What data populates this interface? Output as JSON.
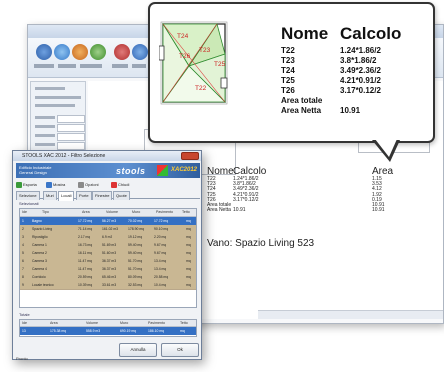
{
  "callout": {
    "header_nome": "Nome",
    "header_calcolo": "Calcolo",
    "rows": [
      {
        "nome": "T22",
        "calcolo": "1.24*1.86/2"
      },
      {
        "nome": "T23",
        "calcolo": "3.8*1.86/2"
      },
      {
        "nome": "T24",
        "calcolo": "3.49*2.36/2"
      },
      {
        "nome": "T25",
        "calcolo": "4.21*0.91/2"
      },
      {
        "nome": "T26",
        "calcolo": "3.17*0.12/2"
      },
      {
        "nome": "Area totale",
        "calcolo": ""
      },
      {
        "nome": "Area Netta",
        "calcolo": "10.91"
      }
    ],
    "plan_labels": {
      "t24": "T24",
      "t26": "T26",
      "t23": "T23",
      "t25": "T25",
      "t22": "T22"
    }
  },
  "report": {
    "header_nome": "Nome",
    "header_calcolo": "Calcolo",
    "header_area": "Area",
    "nomi": "T22\nT23\nT24\nT25\nT26\nArea totale\nArea Netta",
    "calcoli": "1.24*1.86/2\n3.8*1.86/2\n3.49*2.36/2\n4.21*0.91/2\n3.17*0.12/2\n\n10.91",
    "aree": "1.15\n3.53\n4.12\n1.92\n0.19\n10.91\n10.91",
    "vano_label": "Vano: Spazio Living 523"
  },
  "dialog": {
    "title": "STOOLS XAC 2012 - Filtro Selezione",
    "banner_left": "Edificio Industriale\nGeneral Design",
    "banner_brand": "stools",
    "banner_product": "XAC2012",
    "toolbar": [
      "Esporta",
      "Mostra",
      "Opzioni",
      "Chiudi"
    ],
    "tabs": [
      "Selezione",
      "Muri",
      "Locali",
      "Porte",
      "Finestre",
      "Quote"
    ],
    "active_tab": 2,
    "group_selezionati": "Selezionati",
    "columns": [
      "Ide",
      "Tipo",
      "Area",
      "Volume",
      "Muro",
      "Pavimento",
      "Tetto"
    ],
    "rows": [
      {
        "id": "1",
        "tipo": "Bagno",
        "area": "17.72 mq",
        "volume": "56.27 m3",
        "muro": "70.02 mq",
        "pav": "17.72 mq",
        "tetto": "mq"
      },
      {
        "id": "2",
        "tipo": "Spazio Living",
        "area": "71.14 mq",
        "volume": "161.02 m3",
        "muro": "178.90 mq",
        "pav": "90.10 mq",
        "tetto": "mq"
      },
      {
        "id": "3",
        "tipo": "Ripostiglio",
        "area": "2.17 mq",
        "volume": "6.9 m3",
        "muro": "19.12 mq",
        "pav": "2.20 mq",
        "tetto": "mq"
      },
      {
        "id": "4",
        "tipo": "Camera 1",
        "area": "16.73 mq",
        "volume": "51.69 m3",
        "muro": "59.40 mq",
        "pav": "9.67 mq",
        "tetto": "mq"
      },
      {
        "id": "5",
        "tipo": "Camera 2",
        "area": "16.11 mq",
        "volume": "51.60 m3",
        "muro": "59.40 mq",
        "pav": "9.67 mq",
        "tetto": "mq"
      },
      {
        "id": "6",
        "tipo": "Camera 3",
        "area": "11.47 mq",
        "volume": "36.37 m3",
        "muro": "51.70 mq",
        "pav": "13.4 mq",
        "tetto": "mq"
      },
      {
        "id": "7",
        "tipo": "Camera 4",
        "area": "11.47 mq",
        "volume": "36.37 m3",
        "muro": "51.70 mq",
        "pav": "13.4 mq",
        "tetto": "mq"
      },
      {
        "id": "8",
        "tipo": "Corridoio",
        "area": "20.59 mq",
        "volume": "65.46 m3",
        "muro": "80.09 mq",
        "pav": "20.58 mq",
        "tetto": "mq"
      },
      {
        "id": "9",
        "tipo": "Locale tecnico",
        "area": "10.39 mq",
        "volume": "33.61 m3",
        "muro": "32.53 mq",
        "pav": "10.4 mq",
        "tetto": "mq"
      }
    ],
    "selected_row": 1,
    "group_totale": "Totale",
    "total_columns": [
      "Ide",
      "Area",
      "Volume",
      "Muro",
      "Pavimento",
      "Tetto"
    ],
    "total_row": [
      "13",
      "175.38 mq",
      "558.9 m3",
      "690.19 mq",
      "186.10 mq",
      "mq"
    ],
    "button_annulla": "Annulla",
    "button_ok": "Ok",
    "status": "Pronto"
  },
  "cad": {
    "panel_title": "Proprietà"
  }
}
